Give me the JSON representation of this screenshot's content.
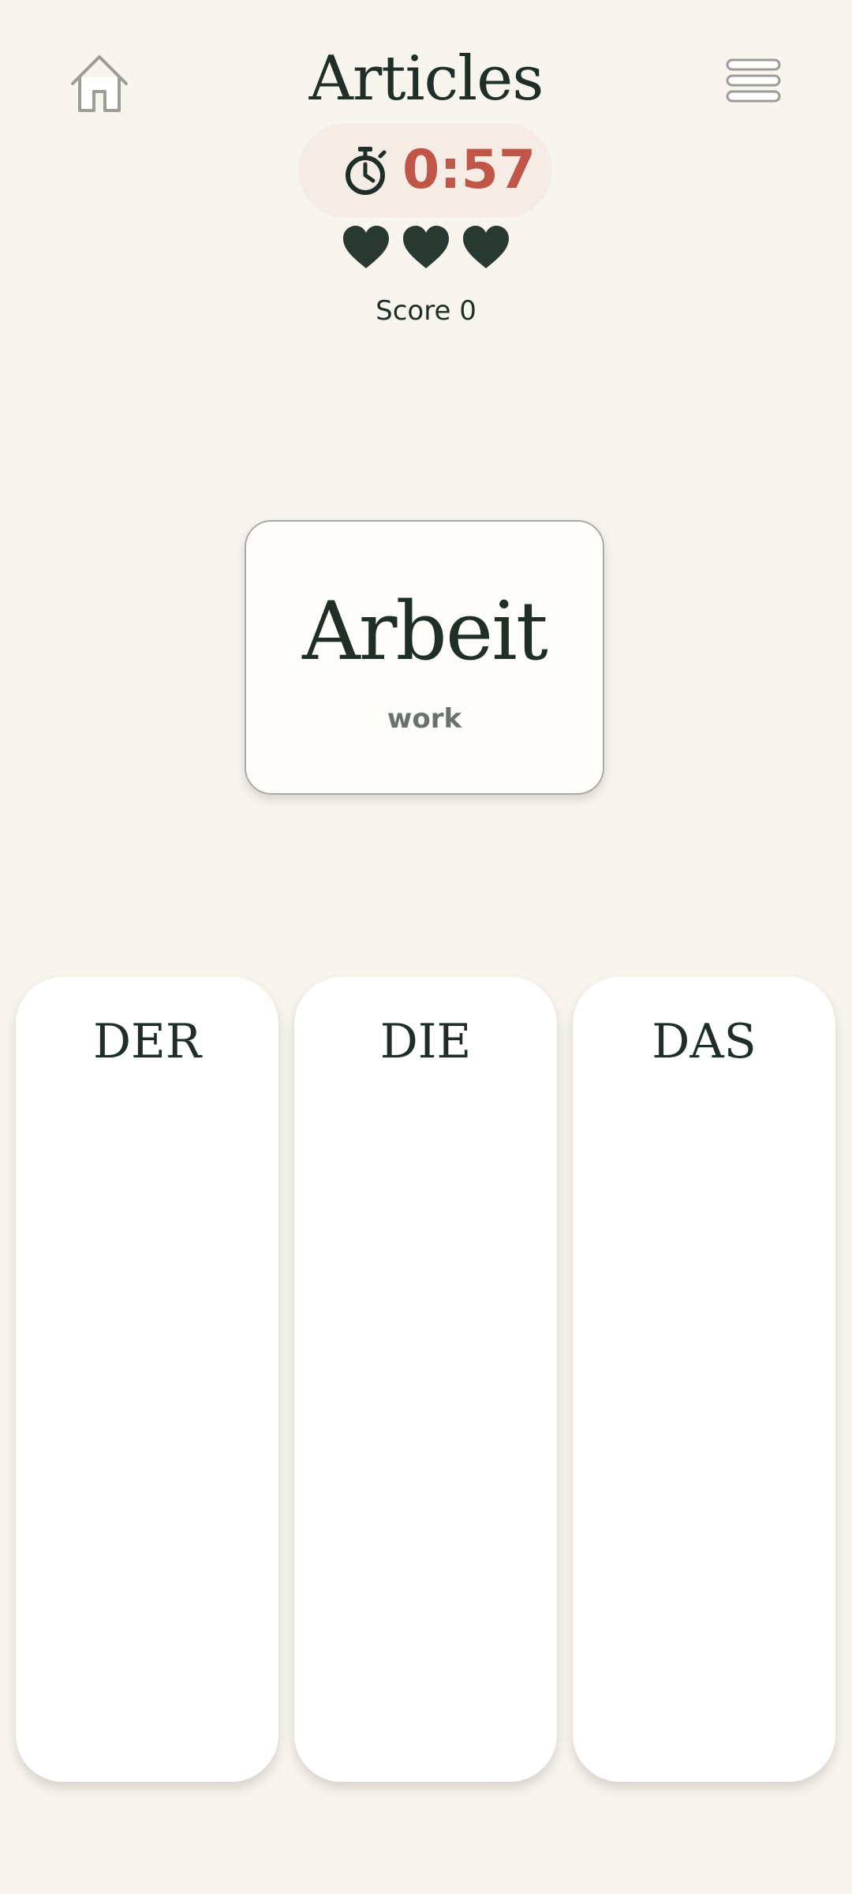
{
  "header": {
    "title": "Articles",
    "home_icon": "home-icon",
    "menu_icon": "menu-icon"
  },
  "timer": {
    "icon": "stopwatch-icon",
    "value": "0:57",
    "color": "#bf5648"
  },
  "lives": {
    "icon": "heart-icon",
    "count": 3,
    "color": "#2a3832"
  },
  "score": {
    "label": "Score 0"
  },
  "card": {
    "word": "Arbeit",
    "translation": "work"
  },
  "columns": [
    {
      "label": "DER"
    },
    {
      "label": "DIE"
    },
    {
      "label": "DAS"
    }
  ],
  "colors": {
    "background": "#f8f4ee",
    "text": "#1f2e27",
    "card": "#fffdf9"
  }
}
